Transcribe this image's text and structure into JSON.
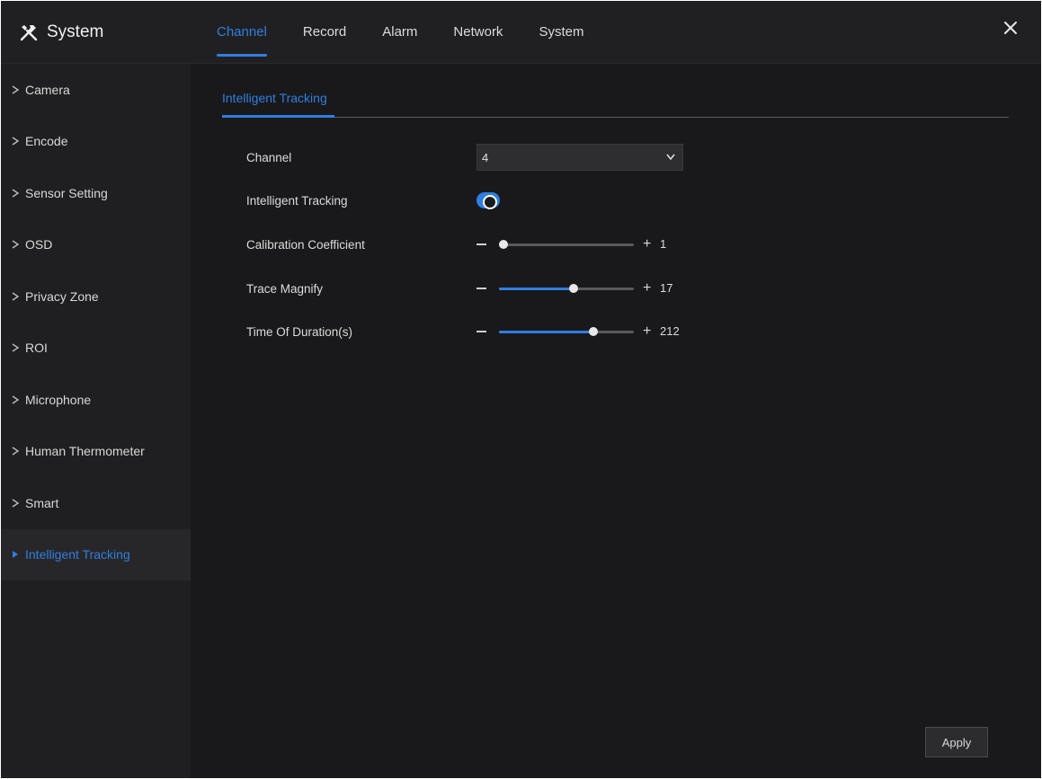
{
  "header": {
    "title": "System",
    "tabs": [
      {
        "label": "Channel",
        "active": true
      },
      {
        "label": "Record"
      },
      {
        "label": "Alarm"
      },
      {
        "label": "Network"
      },
      {
        "label": "System"
      }
    ]
  },
  "sidebar": {
    "items": [
      {
        "label": "Camera"
      },
      {
        "label": "Encode"
      },
      {
        "label": "Sensor Setting"
      },
      {
        "label": "OSD"
      },
      {
        "label": "Privacy Zone"
      },
      {
        "label": "ROI"
      },
      {
        "label": "Microphone"
      },
      {
        "label": "Human Thermometer"
      },
      {
        "label": "Smart"
      },
      {
        "label": "Intelligent Tracking",
        "active": true
      }
    ]
  },
  "main": {
    "subtab": "Intelligent Tracking",
    "channel": {
      "label": "Channel",
      "value": "4"
    },
    "tracking": {
      "label": "Intelligent Tracking",
      "enabled": true
    },
    "sliders": [
      {
        "label": "Calibration Coefficient",
        "value": "1",
        "fraction": 0.03
      },
      {
        "label": "Trace Magnify",
        "value": "17",
        "fraction": 0.55
      },
      {
        "label": "Time Of Duration(s)",
        "value": "212",
        "fraction": 0.7
      }
    ],
    "apply_label": "Apply"
  },
  "colors": {
    "accent": "#2f7fe0",
    "background": "#1b1b1d"
  }
}
